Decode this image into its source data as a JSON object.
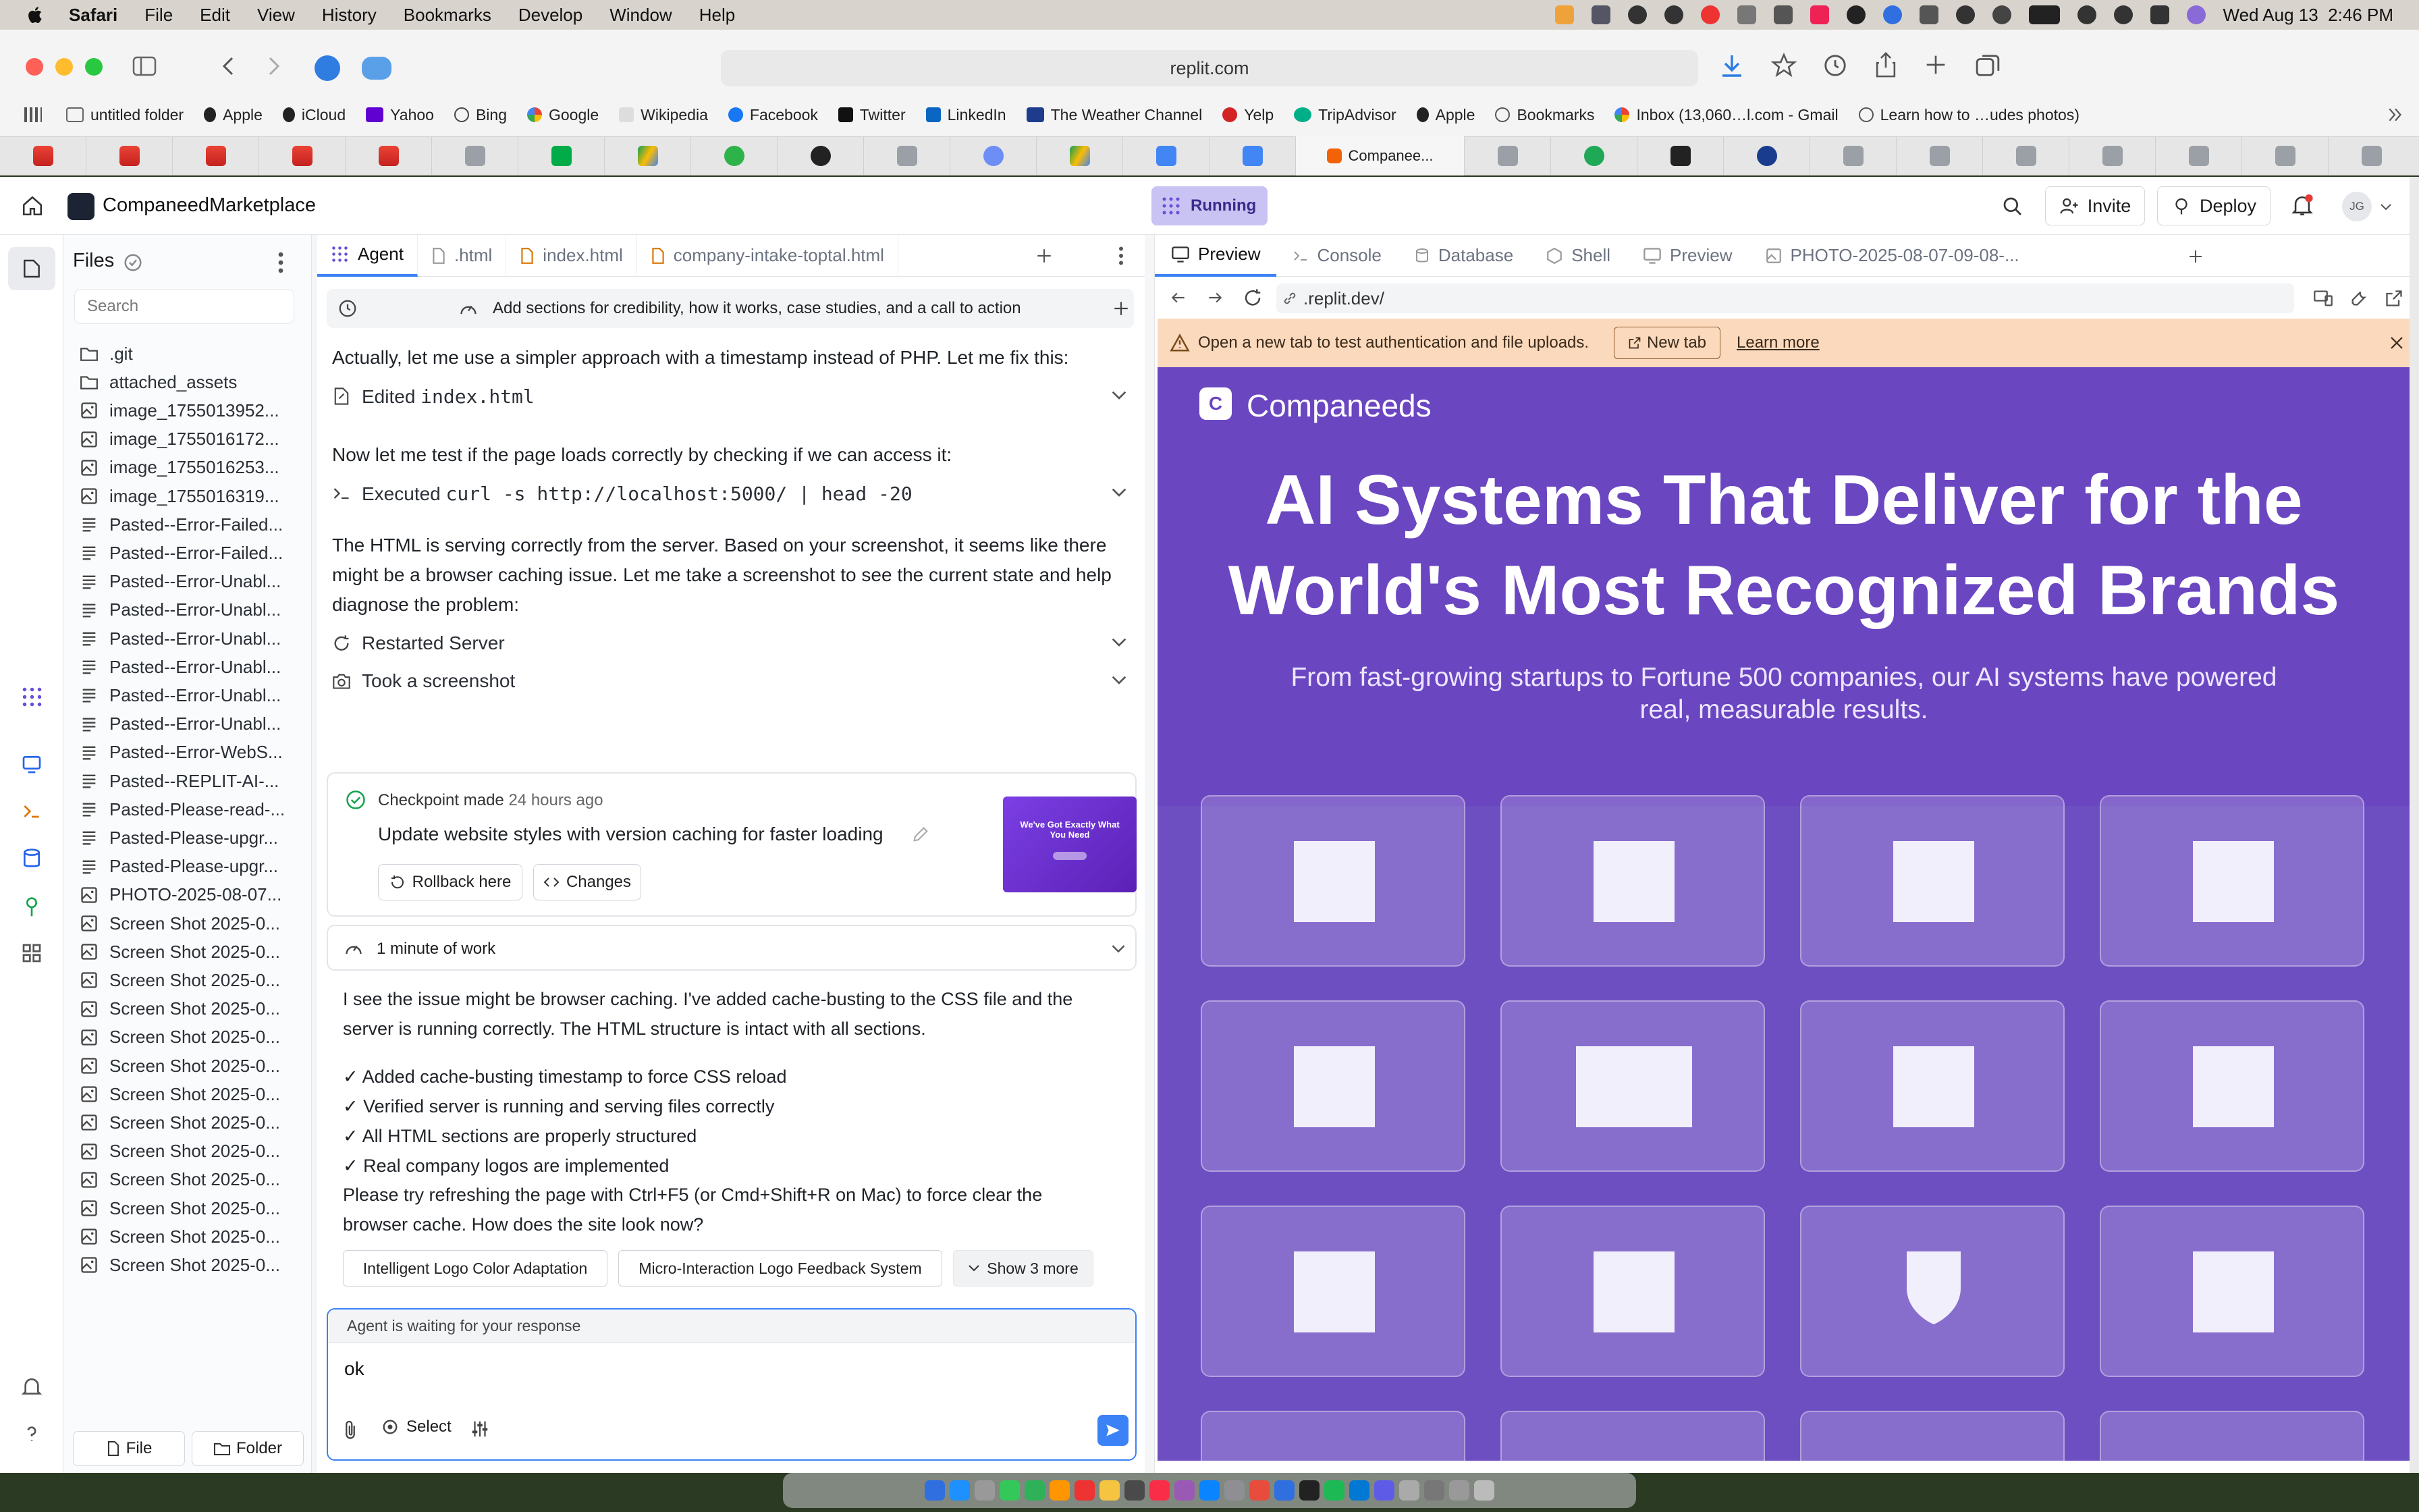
{
  "menubar": {
    "app": "Safari",
    "items": [
      "File",
      "Edit",
      "View",
      "History",
      "Bookmarks",
      "Develop",
      "Window",
      "Help"
    ],
    "clock": "Wed Aug 13  2:46 PM"
  },
  "safari": {
    "url": "replit.com",
    "favorites": [
      "untitled folder",
      "Apple",
      "iCloud",
      "Yahoo",
      "Bing",
      "Google",
      "Wikipedia",
      "Facebook",
      "Twitter",
      "LinkedIn",
      "The Weather Channel",
      "Yelp",
      "TripAdvisor",
      "Apple",
      "Bookmarks",
      "Inbox (13,060…l.com - Gmail",
      "Learn how to …udes photos)"
    ],
    "active_tab": "Companee..."
  },
  "header": {
    "project": "CompaneedMarketplace",
    "status": "Running",
    "invite": "Invite",
    "deploy": "Deploy",
    "avatar": "JG"
  },
  "files": {
    "title": "Files",
    "search_placeholder": "Search",
    "items": [
      {
        "name": ".git",
        "type": "folder"
      },
      {
        "name": "attached_assets",
        "type": "folder"
      },
      {
        "name": "image_1755013952...",
        "type": "image"
      },
      {
        "name": "image_1755016172...",
        "type": "image"
      },
      {
        "name": "image_1755016253...",
        "type": "image"
      },
      {
        "name": "image_1755016319...",
        "type": "image"
      },
      {
        "name": "Pasted--Error-Failed...",
        "type": "text"
      },
      {
        "name": "Pasted--Error-Failed...",
        "type": "text"
      },
      {
        "name": "Pasted--Error-Unabl...",
        "type": "text"
      },
      {
        "name": "Pasted--Error-Unabl...",
        "type": "text"
      },
      {
        "name": "Pasted--Error-Unabl...",
        "type": "text"
      },
      {
        "name": "Pasted--Error-Unabl...",
        "type": "text"
      },
      {
        "name": "Pasted--Error-Unabl...",
        "type": "text"
      },
      {
        "name": "Pasted--Error-Unabl...",
        "type": "text"
      },
      {
        "name": "Pasted--Error-WebS...",
        "type": "text"
      },
      {
        "name": "Pasted--REPLIT-AI-...",
        "type": "text"
      },
      {
        "name": "Pasted-Please-read-...",
        "type": "text"
      },
      {
        "name": "Pasted-Please-upgr...",
        "type": "text"
      },
      {
        "name": "Pasted-Please-upgr...",
        "type": "text"
      },
      {
        "name": "PHOTO-2025-08-07...",
        "type": "image"
      },
      {
        "name": "Screen Shot 2025-0...",
        "type": "image"
      },
      {
        "name": "Screen Shot 2025-0...",
        "type": "image"
      },
      {
        "name": "Screen Shot 2025-0...",
        "type": "image"
      },
      {
        "name": "Screen Shot 2025-0...",
        "type": "image"
      },
      {
        "name": "Screen Shot 2025-0...",
        "type": "image"
      },
      {
        "name": "Screen Shot 2025-0...",
        "type": "image"
      },
      {
        "name": "Screen Shot 2025-0...",
        "type": "image"
      },
      {
        "name": "Screen Shot 2025-0...",
        "type": "image"
      },
      {
        "name": "Screen Shot 2025-0...",
        "type": "image"
      },
      {
        "name": "Screen Shot 2025-0...",
        "type": "image"
      },
      {
        "name": "Screen Shot 2025-0...",
        "type": "image"
      },
      {
        "name": "Screen Shot 2025-0...",
        "type": "image"
      },
      {
        "name": "Screen Shot 2025-0...",
        "type": "image"
      }
    ],
    "new_file": "File",
    "new_folder": "Folder"
  },
  "agent": {
    "tabs": [
      "Agent",
      ".html",
      "index.html",
      "company-intake-toptal.html"
    ],
    "task": "Add sections for credibility, how it works, case studies, and a call to action",
    "msg1": "Actually, let me use a simpler approach with a timestamp instead of PHP. Let me fix this:",
    "action_edit_prefix": "Edited ",
    "action_edit_file": "index.html",
    "msg2": "Now let me test if the page loads correctly by checking if we can access it:",
    "action_exec_prefix": "Executed ",
    "action_exec_cmd": "curl -s http://localhost:5000/ | head -20",
    "msg3_line1": "The HTML is serving correctly from the server. Based on your screenshot, it seems like there",
    "msg3_line2": "might be a browser caching issue. Let me take a screenshot to see the current state and help",
    "msg3_line3": "diagnose the problem:",
    "action_restart": "Restarted Server",
    "action_screenshot": "Took a screenshot",
    "checkpoint_label": "Checkpoint made",
    "checkpoint_time": "24 hours ago",
    "checkpoint_title": "Update website styles with version caching for faster loading",
    "checkpoint_thumb_text": "We've Got Exactly What You Need",
    "rollback": "Rollback here",
    "changes": "Changes",
    "work": "1 minute of work",
    "msg4_line1": "I see the issue might be browser caching. I've added cache-busting to the CSS file and the",
    "msg4_line2": "server is running correctly. The HTML structure is intact with all sections.",
    "checks": [
      "✓ Added cache-busting timestamp to force CSS reload",
      "✓ Verified server is running and serving files correctly",
      "✓ All HTML sections are properly structured",
      "✓ Real company logos are implemented"
    ],
    "msg5_line1": "Please try refreshing the page with Ctrl+F5 (or Cmd+Shift+R on Mac) to force clear the",
    "msg5_line2": "browser cache. How does the site look now?",
    "suggestions": [
      "Intelligent Logo Color Adaptation",
      "Micro-Interaction Logo Feedback System",
      "Show 3 more"
    ],
    "waiting": "Agent is waiting for your response",
    "input_value": "ok",
    "select": "Select"
  },
  "preview": {
    "tabs": [
      "Preview",
      "Console",
      "Database",
      "Shell",
      "Preview",
      "PHOTO-2025-08-07-09-08-..."
    ],
    "url": ".replit.dev/",
    "banner": "Open a new tab to test authentication and file uploads.",
    "new_tab": "New tab",
    "learn_more": "Learn more",
    "site_brand": "Companeeds",
    "site_logo_letter": "C",
    "headline_line1": "AI Systems That Deliver for the",
    "headline_line2": "World's Most Recognized Brands",
    "sub_line1": "From fast-growing startups to Fortune 500 companies, our AI systems have powered",
    "sub_line2": "real, measurable results."
  },
  "colors": {
    "accent": "#3b82f6",
    "site_purple": "#6b46c1",
    "running_badge": "#c9c3f3",
    "banner": "#fbd9bd"
  }
}
